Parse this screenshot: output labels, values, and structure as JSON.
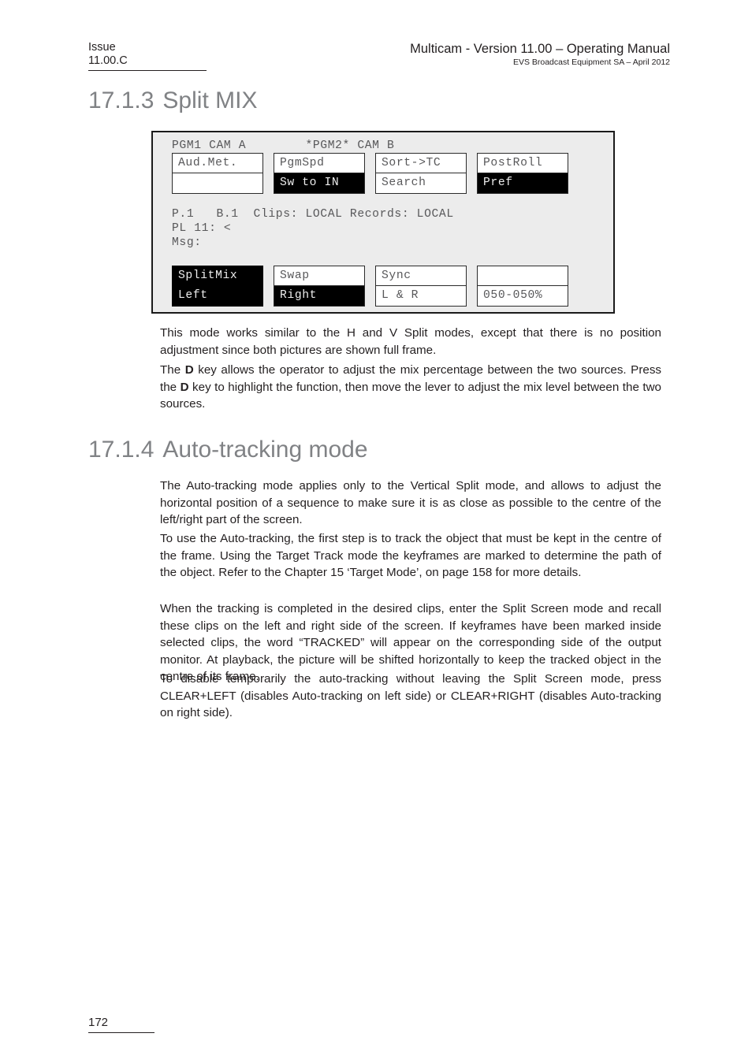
{
  "header": {
    "issue_label": "Issue",
    "issue_value": "11.00.C",
    "title": "Multicam - Version 11.00 – Operating Manual",
    "subtitle": "EVS Broadcast Equipment SA – April 2012"
  },
  "sections": [
    {
      "number": "17.1.3",
      "title": "Split MIX"
    },
    {
      "number": "17.1.4",
      "title": "Auto-tracking mode"
    }
  ],
  "terminal": {
    "top_line": "PGM1 CAM A        *PGM2* CAM B",
    "status_line_1": "P.1   B.1  Clips: LOCAL Records: LOCAL",
    "status_line_2": "PL 11: <",
    "status_line_3": "Msg:",
    "row1": [
      {
        "top": "Aud.Met.",
        "bottom": "",
        "top_inverted": false,
        "bottom_inverted": false
      },
      {
        "top": "PgmSpd",
        "bottom": "Sw to IN",
        "top_inverted": false,
        "bottom_inverted": true
      },
      {
        "top": "Sort->TC",
        "bottom": "Search",
        "top_inverted": false,
        "bottom_inverted": false
      },
      {
        "top": "PostRoll",
        "bottom": "Pref",
        "top_inverted": false,
        "bottom_inverted": true
      }
    ],
    "row2": [
      {
        "top": "SplitMix",
        "bottom": "Left",
        "top_inverted": true,
        "bottom_inverted": true
      },
      {
        "top": "Swap",
        "bottom": "Right",
        "top_inverted": false,
        "bottom_inverted": true
      },
      {
        "top": "Sync",
        "bottom": "L & R",
        "top_inverted": false,
        "bottom_inverted": false
      },
      {
        "top": "",
        "bottom": "050-050%",
        "top_inverted": false,
        "bottom_inverted": false
      }
    ]
  },
  "paragraphs": {
    "p1": "This mode works similar to the H and V Split modes, except that there is no position adjustment since both pictures are shown full frame.",
    "p2_part1": "The ",
    "p2_key1": "D",
    "p2_part2": " key allows the operator to adjust the mix percentage between the two sources. Press the ",
    "p2_key2": "D",
    "p2_part3": " key to highlight the function, then move the lever to adjust the mix level between the two sources.",
    "p3": "The Auto-tracking mode applies only to the Vertical Split mode, and allows to adjust the horizontal position of a sequence to make sure it is as close as possible to the centre of the left/right part of the screen.",
    "p4": "To use the Auto-tracking, the first step is to track the object that must be kept in the centre of the frame. Using the Target Track mode the keyframes are marked to determine the path of the object. Refer to the Chapter 15 ‘Target Mode’, on page 158 for more details.",
    "p5": "When the tracking is completed in the desired clips, enter the Split Screen mode and recall these clips on the left and right side of the screen. If keyframes have been marked inside selected clips, the word “TRACKED” will appear on the corresponding side of the output monitor. At playback, the picture will be shifted horizontally to keep the tracked object in the centre of its frame.",
    "p6": "To disable temporarily the auto-tracking without leaving the Split Screen mode, press CLEAR+LEFT (disables Auto-tracking on left side) or CLEAR+RIGHT (disables Auto-tracking on right side)."
  },
  "footer": {
    "page_number": "172"
  },
  "colors": {
    "heading": "#808285",
    "text": "#231f20",
    "panel_bg": "#ececec",
    "panel_border": "#1a1a1a",
    "cell_bg": "#ffffff",
    "cell_inverted_bg": "#000000"
  }
}
